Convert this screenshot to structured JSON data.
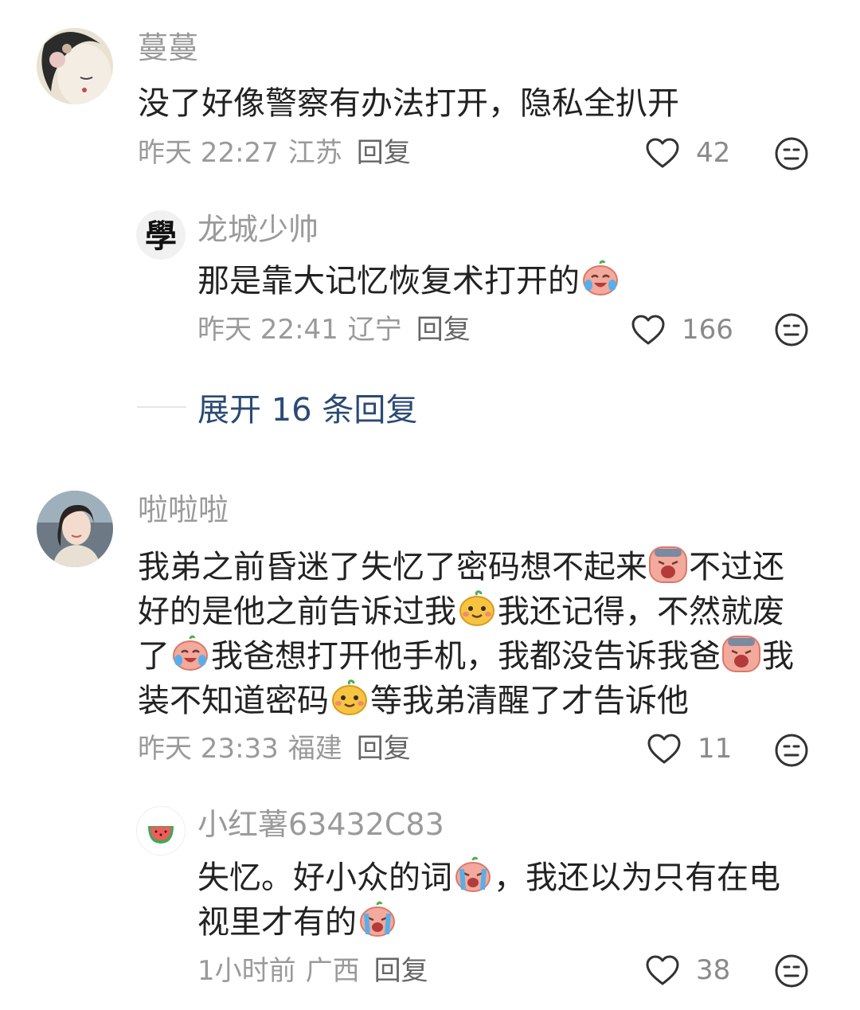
{
  "comments": [
    {
      "user": "蔓蔓",
      "text": [
        "没了好像警察有办法打开，隐私全扒开"
      ],
      "time": "昨天 22:27",
      "location": "江苏",
      "reply_label": "回复",
      "likes": "42",
      "replies": [
        {
          "user": "龙城少帅",
          "avatar_text": "學",
          "text_before": "那是靠大记忆恢复术打开的",
          "time": "昨天 22:41",
          "location": "辽宁",
          "reply_label": "回复",
          "likes": "166"
        }
      ],
      "expand_label": "展开 16 条回复"
    },
    {
      "user": "啦啦啦",
      "text_lines": [
        {
          "a": "我弟之前昏迷了失忆了密码想不起来",
          "b": "不过还"
        },
        {
          "a": "好的是他之前告诉过我",
          "b": "我还记得，不然就废"
        },
        {
          "a": "了",
          "b": "我爸想打开他手机，我都没告诉我爸",
          "c": "我"
        },
        {
          "a": "装不知道密码",
          "b": "等我弟清醒了才告诉他"
        }
      ],
      "time": "昨天 23:33",
      "location": "福建",
      "reply_label": "回复",
      "likes": "11",
      "replies": [
        {
          "user": "小红薯63432C83",
          "line1_a": "失忆。好小众的词",
          "line1_b": "，我还以为只有在电",
          "line2_a": "视里才有的",
          "time": "1小时前",
          "location": "广西",
          "reply_label": "回复",
          "likes": "38"
        }
      ]
    }
  ],
  "icons": {
    "like": "heart-outline-icon",
    "dislike": "neutral-face-icon",
    "emojis": [
      "crying-laugh-emoji",
      "screaming-emoji",
      "smug-face-emoji",
      "sobbing-emoji"
    ]
  },
  "colors": {
    "username": "#9a9a9a",
    "body_text": "#222222",
    "expand_link": "#2b4a74",
    "emoji_pink": "#f3a99c"
  }
}
